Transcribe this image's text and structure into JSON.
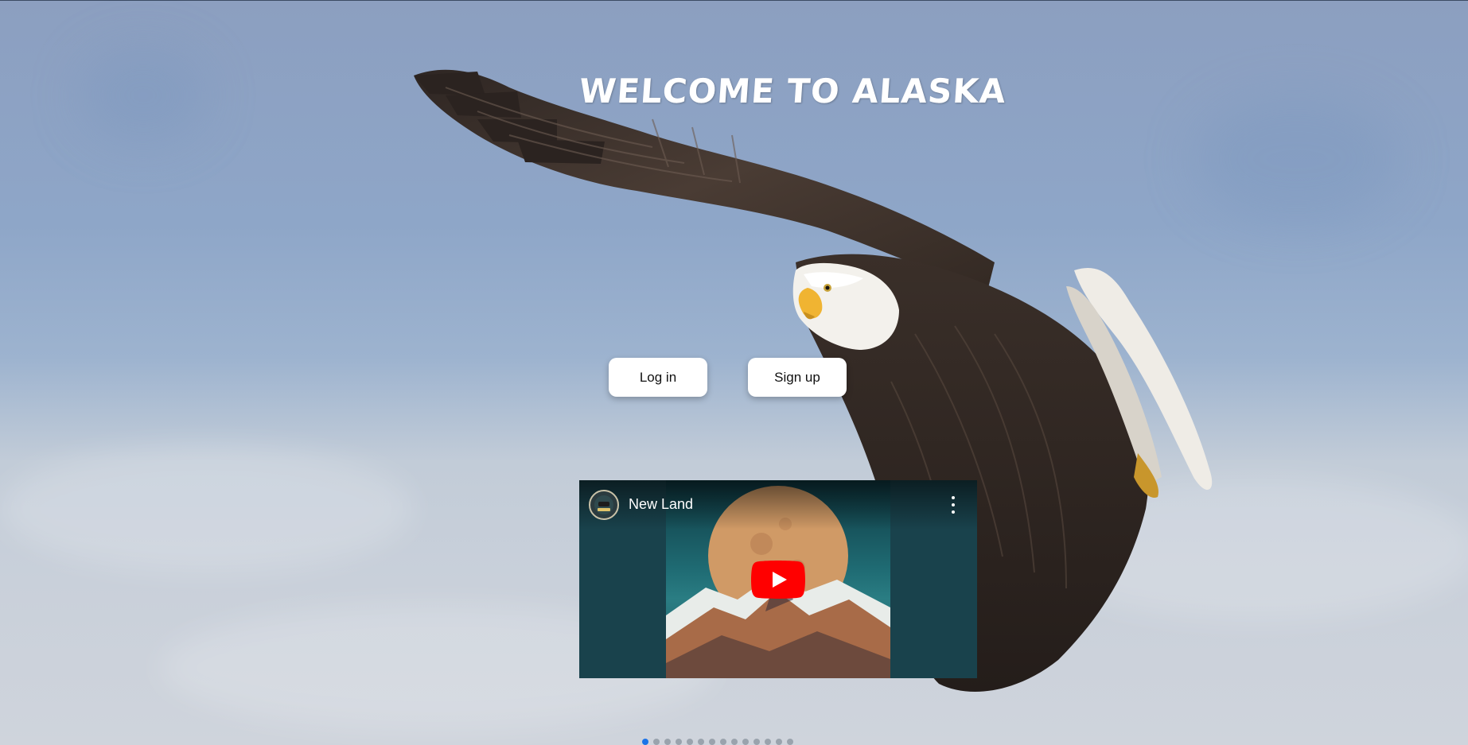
{
  "hero": {
    "title": "WELCOME TO ALASKA"
  },
  "auth": {
    "login_label": "Log in",
    "signup_label": "Sign up"
  },
  "video": {
    "title": "New Land",
    "channel_avatar": "channel-avatar",
    "menu_icon": "more-vert-icon",
    "play_icon": "youtube-play-icon"
  },
  "carousel": {
    "total_slides": 14,
    "active_index": 0
  },
  "colors": {
    "accent": "#1a73e8",
    "play_red": "#ff0000"
  }
}
